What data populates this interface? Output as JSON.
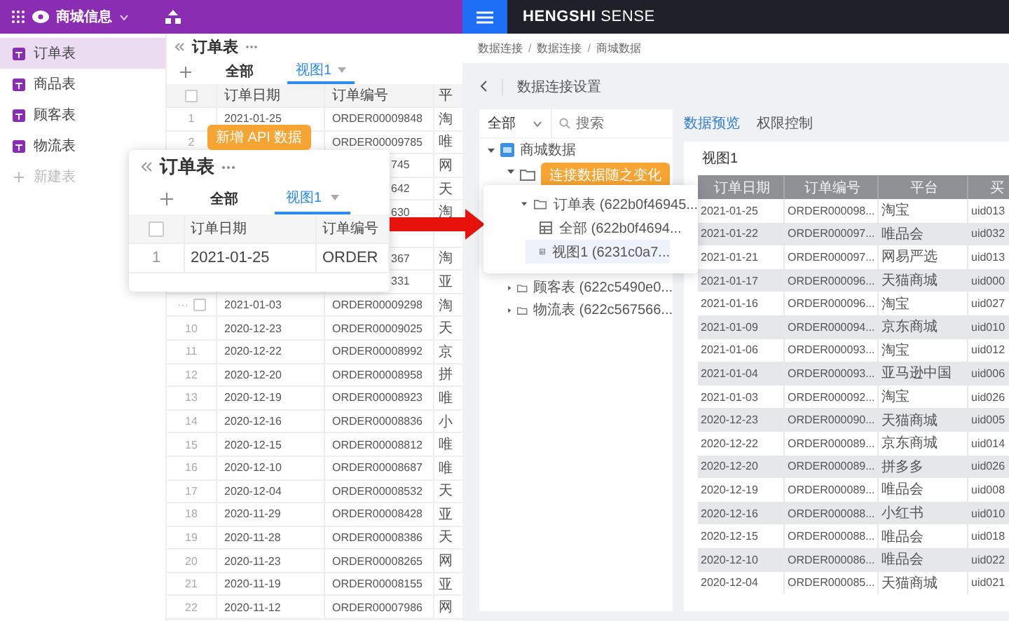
{
  "left_app": {
    "app_name": "商城信息",
    "sidebar": [
      {
        "label": "订单表",
        "selected": true
      },
      {
        "label": "商品表",
        "selected": false
      },
      {
        "label": "顾客表",
        "selected": false
      },
      {
        "label": "物流表",
        "selected": false
      }
    ],
    "add_table": "新建表",
    "table_title": "订单表",
    "tabs": [
      {
        "label": "全部",
        "selected": false
      },
      {
        "label": "视图1",
        "selected": true
      }
    ],
    "header_checked": false,
    "columns": [
      "订单日期",
      "订单编号",
      "平"
    ],
    "rows": [
      {
        "kind": "full",
        "num": "1",
        "date": "2021-01-25",
        "order": "ORDER00009848",
        "platform": "淘"
      },
      {
        "kind": "full",
        "num": "2",
        "order": "ORDER00009785",
        "platform": "唯"
      },
      {
        "kind": "covered",
        "order": "745",
        "platform": "网"
      },
      {
        "kind": "covered",
        "order": "642",
        "platform": "天"
      },
      {
        "kind": "covered",
        "order": "630",
        "platform": "淘"
      },
      {
        "kind": "blank"
      },
      {
        "kind": "covered",
        "order": "367",
        "platform": "淘"
      },
      {
        "kind": "covered",
        "order": "331",
        "platform": "亚"
      },
      {
        "kind": "hover",
        "num": "···",
        "checked": false,
        "date": "2021-01-03",
        "order": "ORDER00009298",
        "platform": "淘"
      },
      {
        "kind": "full",
        "num": "10",
        "date": "2020-12-23",
        "order": "ORDER00009025",
        "platform": "天"
      },
      {
        "kind": "full",
        "num": "11",
        "date": "2020-12-22",
        "order": "ORDER00008992",
        "platform": "京"
      },
      {
        "kind": "full",
        "num": "12",
        "date": "2020-12-20",
        "order": "ORDER00008958",
        "platform": "拼"
      },
      {
        "kind": "full",
        "num": "13",
        "date": "2020-12-19",
        "order": "ORDER00008923",
        "platform": "唯"
      },
      {
        "kind": "full",
        "num": "14",
        "date": "2020-12-16",
        "order": "ORDER00008836",
        "platform": "小"
      },
      {
        "kind": "full",
        "num": "15",
        "date": "2020-12-15",
        "order": "ORDER00008812",
        "platform": "唯"
      },
      {
        "kind": "full",
        "num": "16",
        "date": "2020-12-10",
        "order": "ORDER00008687",
        "platform": "唯"
      },
      {
        "kind": "full",
        "num": "17",
        "date": "2020-12-04",
        "order": "ORDER00008532",
        "platform": "天"
      },
      {
        "kind": "full",
        "num": "18",
        "date": "2020-11-29",
        "order": "ORDER00008428",
        "platform": "亚"
      },
      {
        "kind": "full",
        "num": "19",
        "date": "2020-11-28",
        "order": "ORDER00008386",
        "platform": "天"
      },
      {
        "kind": "full",
        "num": "20",
        "date": "2020-11-23",
        "order": "ORDER00008265",
        "platform": "网"
      },
      {
        "kind": "full",
        "num": "21",
        "date": "2020-11-19",
        "order": "ORDER00008155",
        "platform": "亚"
      },
      {
        "kind": "full",
        "num": "22",
        "date": "2020-11-12",
        "order": "ORDER00007986",
        "platform": "网"
      }
    ]
  },
  "zoom_card": {
    "title": "订单表",
    "tabs": [
      {
        "label": "全部",
        "selected": false
      },
      {
        "label": "视图1",
        "selected": true
      }
    ],
    "header_checked": false,
    "columns": [
      "订单日期",
      "订单编号"
    ],
    "rows": [
      {
        "num": "1",
        "date": "2021-01-25",
        "order": "ORDER"
      }
    ]
  },
  "badges": [
    "新增 API 数据",
    "连接数据随之变化"
  ],
  "right_app": {
    "brand_bold": "HENGSHI",
    "brand": "SENSE",
    "breadcrumb": [
      "数据连接",
      "数据连接",
      "商城数据"
    ],
    "breadcrumb_separator": "/",
    "page_title": "数据连接设置",
    "filter": "全部",
    "search_placeholder": "搜索",
    "tree": [
      {
        "kind": "source",
        "label": "商城数据",
        "expanded": true,
        "children": [
          {
            "kind": "folder",
            "expanded": true,
            "covered": true
          },
          {
            "kind": "folder",
            "label": "顾客表 (622c5490e0...",
            "expanded": false,
            "covered": false
          },
          {
            "kind": "folder",
            "label": "物流表 (622c567566...",
            "expanded": false,
            "covered": false
          }
        ]
      }
    ],
    "popup": [
      {
        "kind": "folder",
        "label": "订单表 (622b0f46945...",
        "expanded": true,
        "children": [
          {
            "kind": "table",
            "label": "全部 (622b0f4694...",
            "selected": false
          },
          {
            "kind": "table",
            "label": "视图1 (6231c0a7...",
            "selected": true
          }
        ]
      }
    ],
    "tabs": [
      {
        "label": "数据预览",
        "selected": true
      },
      {
        "label": "权限控制",
        "selected": false
      }
    ],
    "view_title": "视图1",
    "columns": [
      "订单日期",
      "订单编号",
      "平台",
      "买"
    ],
    "rows": [
      [
        "2021-01-25",
        "ORDER000098...",
        "淘宝",
        "uid013"
      ],
      [
        "2021-01-22",
        "ORDER000097...",
        "唯品会",
        "uid032"
      ],
      [
        "2021-01-21",
        "ORDER000097...",
        "网易严选",
        "uid013"
      ],
      [
        "2021-01-17",
        "ORDER000096...",
        "天猫商城",
        "uid000"
      ],
      [
        "2021-01-16",
        "ORDER000096...",
        "淘宝",
        "uid027"
      ],
      [
        "2021-01-09",
        "ORDER000094...",
        "京东商城",
        "uid010"
      ],
      [
        "2021-01-06",
        "ORDER000093...",
        "淘宝",
        "uid012"
      ],
      [
        "2021-01-04",
        "ORDER000093...",
        "亚马逊中国",
        "uid006"
      ],
      [
        "2021-01-03",
        "ORDER000092...",
        "淘宝",
        "uid026"
      ],
      [
        "2020-12-23",
        "ORDER000090...",
        "天猫商城",
        "uid005"
      ],
      [
        "2020-12-22",
        "ORDER000089...",
        "京东商城",
        "uid014"
      ],
      [
        "2020-12-20",
        "ORDER000089...",
        "拼多多",
        "uid026"
      ],
      [
        "2020-12-19",
        "ORDER000089...",
        "唯品会",
        "uid008"
      ],
      [
        "2020-12-16",
        "ORDER000088...",
        "小红书",
        "uid010"
      ],
      [
        "2020-12-15",
        "ORDER000088...",
        "唯品会",
        "uid018"
      ],
      [
        "2020-12-10",
        "ORDER000086...",
        "唯品会",
        "uid022"
      ],
      [
        "2020-12-04",
        "ORDER000085...",
        "天猫商城",
        "uid021"
      ]
    ]
  }
}
